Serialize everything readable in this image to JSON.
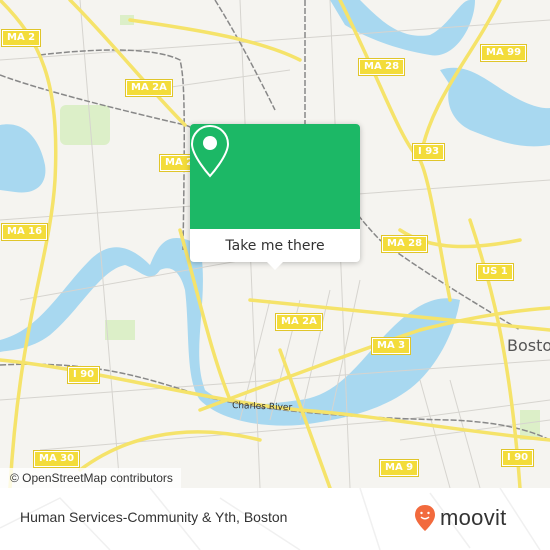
{
  "map": {
    "route_shields": [
      {
        "label": "MA 2"
      },
      {
        "label": "MA 2A"
      },
      {
        "label": "MA 2"
      },
      {
        "label": "MA 16"
      },
      {
        "label": "MA 28"
      },
      {
        "label": "MA 99"
      },
      {
        "label": "I 93"
      },
      {
        "label": "MA 28"
      },
      {
        "label": "US 1"
      },
      {
        "label": "MA 2A"
      },
      {
        "label": "MA 3"
      },
      {
        "label": "I 90"
      },
      {
        "label": "I 90"
      },
      {
        "label": "MA 30"
      },
      {
        "label": "MA 9"
      }
    ],
    "place_label": "Boston",
    "river_label": "Charles River",
    "attribution": "© OpenStreetMap contributors",
    "colors": {
      "water": "#a8d8f0",
      "road": "#f5e36a",
      "park": "#dcefc8",
      "land": "#f5f4f0"
    }
  },
  "popup": {
    "icon": "map-pin-icon",
    "button_label": "Take me there",
    "accent_color": "#1cb866"
  },
  "footer": {
    "title": "Human Services-Community & Yth, Boston",
    "brand": "moovit",
    "brand_color": "#f26a3d"
  }
}
